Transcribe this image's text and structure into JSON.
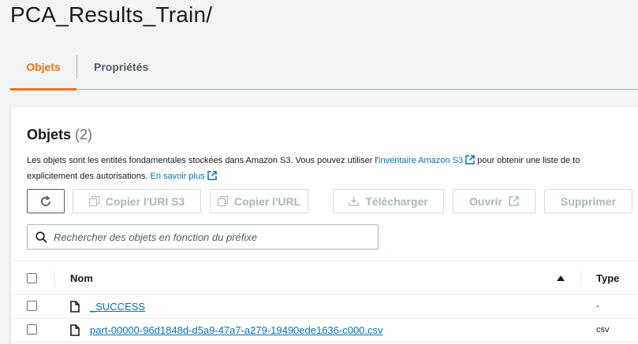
{
  "page": {
    "title": "PCA_Results_Train/"
  },
  "tabs": [
    {
      "label": "Objets",
      "active": true
    },
    {
      "label": "Propriétés",
      "active": false
    }
  ],
  "panel": {
    "title": "Objets",
    "count": "(2)",
    "description_line1_pre": "Les objets sont les entités fondamentales stockées dans Amazon S3. Vous pouvez utiliser l'",
    "description_line1_link": "inventaire Amazon S3",
    "description_line1_post": " pour obtenir une liste de to",
    "description_line2_pre": "explicitement des autorisations. ",
    "description_line2_link": "En savoir plus"
  },
  "toolbar": {
    "refresh_icon": "refresh-icon",
    "copy_uri_label": "Copier l'URI S3",
    "copy_url_label": "Copier l'URL",
    "download_label": "Télécharger",
    "open_label": "Ouvrir",
    "delete_label": "Supprimer"
  },
  "search": {
    "placeholder": "Rechercher des objets en fonction du préfixe"
  },
  "table": {
    "columns": [
      "Nom",
      "Type"
    ],
    "rows": [
      {
        "name": "_SUCCESS",
        "type": "-"
      },
      {
        "name": "part-00000-96d1848d-d5a9-47a7-a279-19490ede1636-c000.csv",
        "type": "csv"
      }
    ]
  },
  "colors": {
    "accent": "#ec7211",
    "link": "#0073bb",
    "text": "#16191f",
    "disabled": "#aab7b8"
  }
}
